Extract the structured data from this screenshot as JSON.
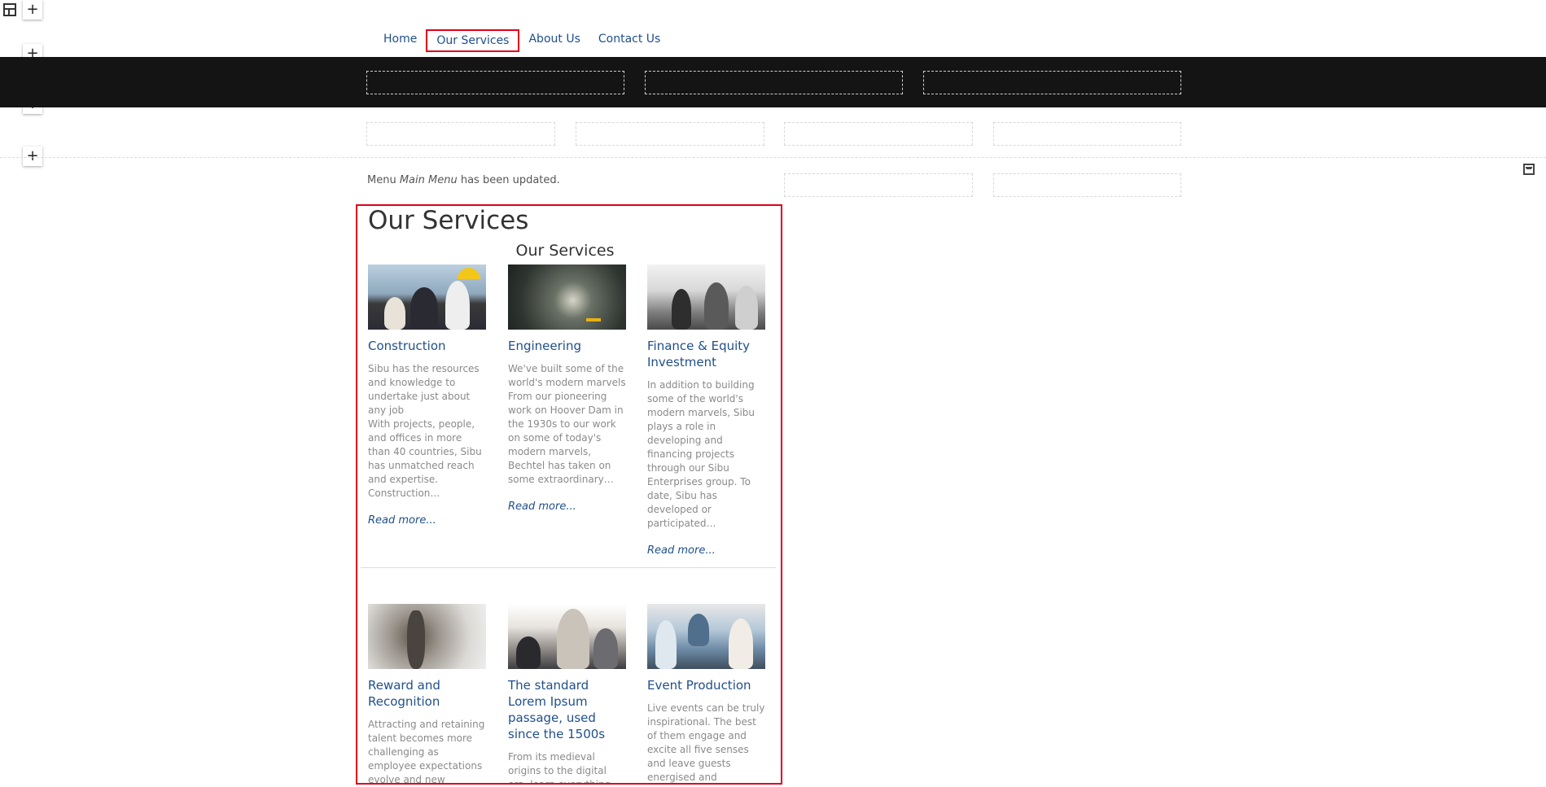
{
  "nav": {
    "items": [
      {
        "label": "Home",
        "active": false
      },
      {
        "label": "Our Services",
        "active": true
      },
      {
        "label": "About Us",
        "active": false
      },
      {
        "label": "Contact Us",
        "active": false
      }
    ]
  },
  "editor": {
    "add_glyph": "+",
    "icons": [
      "layout-icon",
      "add-icon",
      "widget-icon"
    ]
  },
  "status": {
    "prefix": "Menu",
    "menu_name": "Main Menu",
    "suffix": "has been updated."
  },
  "page": {
    "title": "Our Services",
    "subtitle": "Our Services"
  },
  "services": [
    {
      "title": "Construction",
      "text": "Sibu has the resources and knowledge to undertake just about any job\nWith projects, people, and offices in more than 40 countries, Sibu has unmatched reach and expertise. Construction…",
      "read_more": "Read more..."
    },
    {
      "title": "Engineering",
      "text": "We've built some of the world's modern marvels From our pioneering work on Hoover Dam in the 1930s to our work on some of today's modern marvels, Bechtel has taken on some extraordinary…",
      "read_more": "Read more..."
    },
    {
      "title": "Finance & Equity Investment",
      "text": "In addition to building some of the world's modern marvels, Sibu plays a role in developing and financing projects through our Sibu Enterprises group. To date, Sibu has developed or participated…",
      "read_more": "Read more..."
    },
    {
      "title": "Reward and Recognition",
      "text": "Attracting and retaining talent becomes more challenging as employee expectations evolve and new generations join the",
      "read_more": ""
    },
    {
      "title": "The standard Lorem Ipsum passage, used since the 1500s",
      "text": "From its medieval origins to the digital era, learn everything there is to know about the",
      "read_more": ""
    },
    {
      "title": "Event Production",
      "text": "Live events can be truly inspirational. The best of them engage and excite all five senses and leave guests energised and delighted. To",
      "read_more": ""
    }
  ],
  "colors": {
    "link": "#1f4f8b",
    "highlight": "#e0001b",
    "band": "#141414"
  }
}
